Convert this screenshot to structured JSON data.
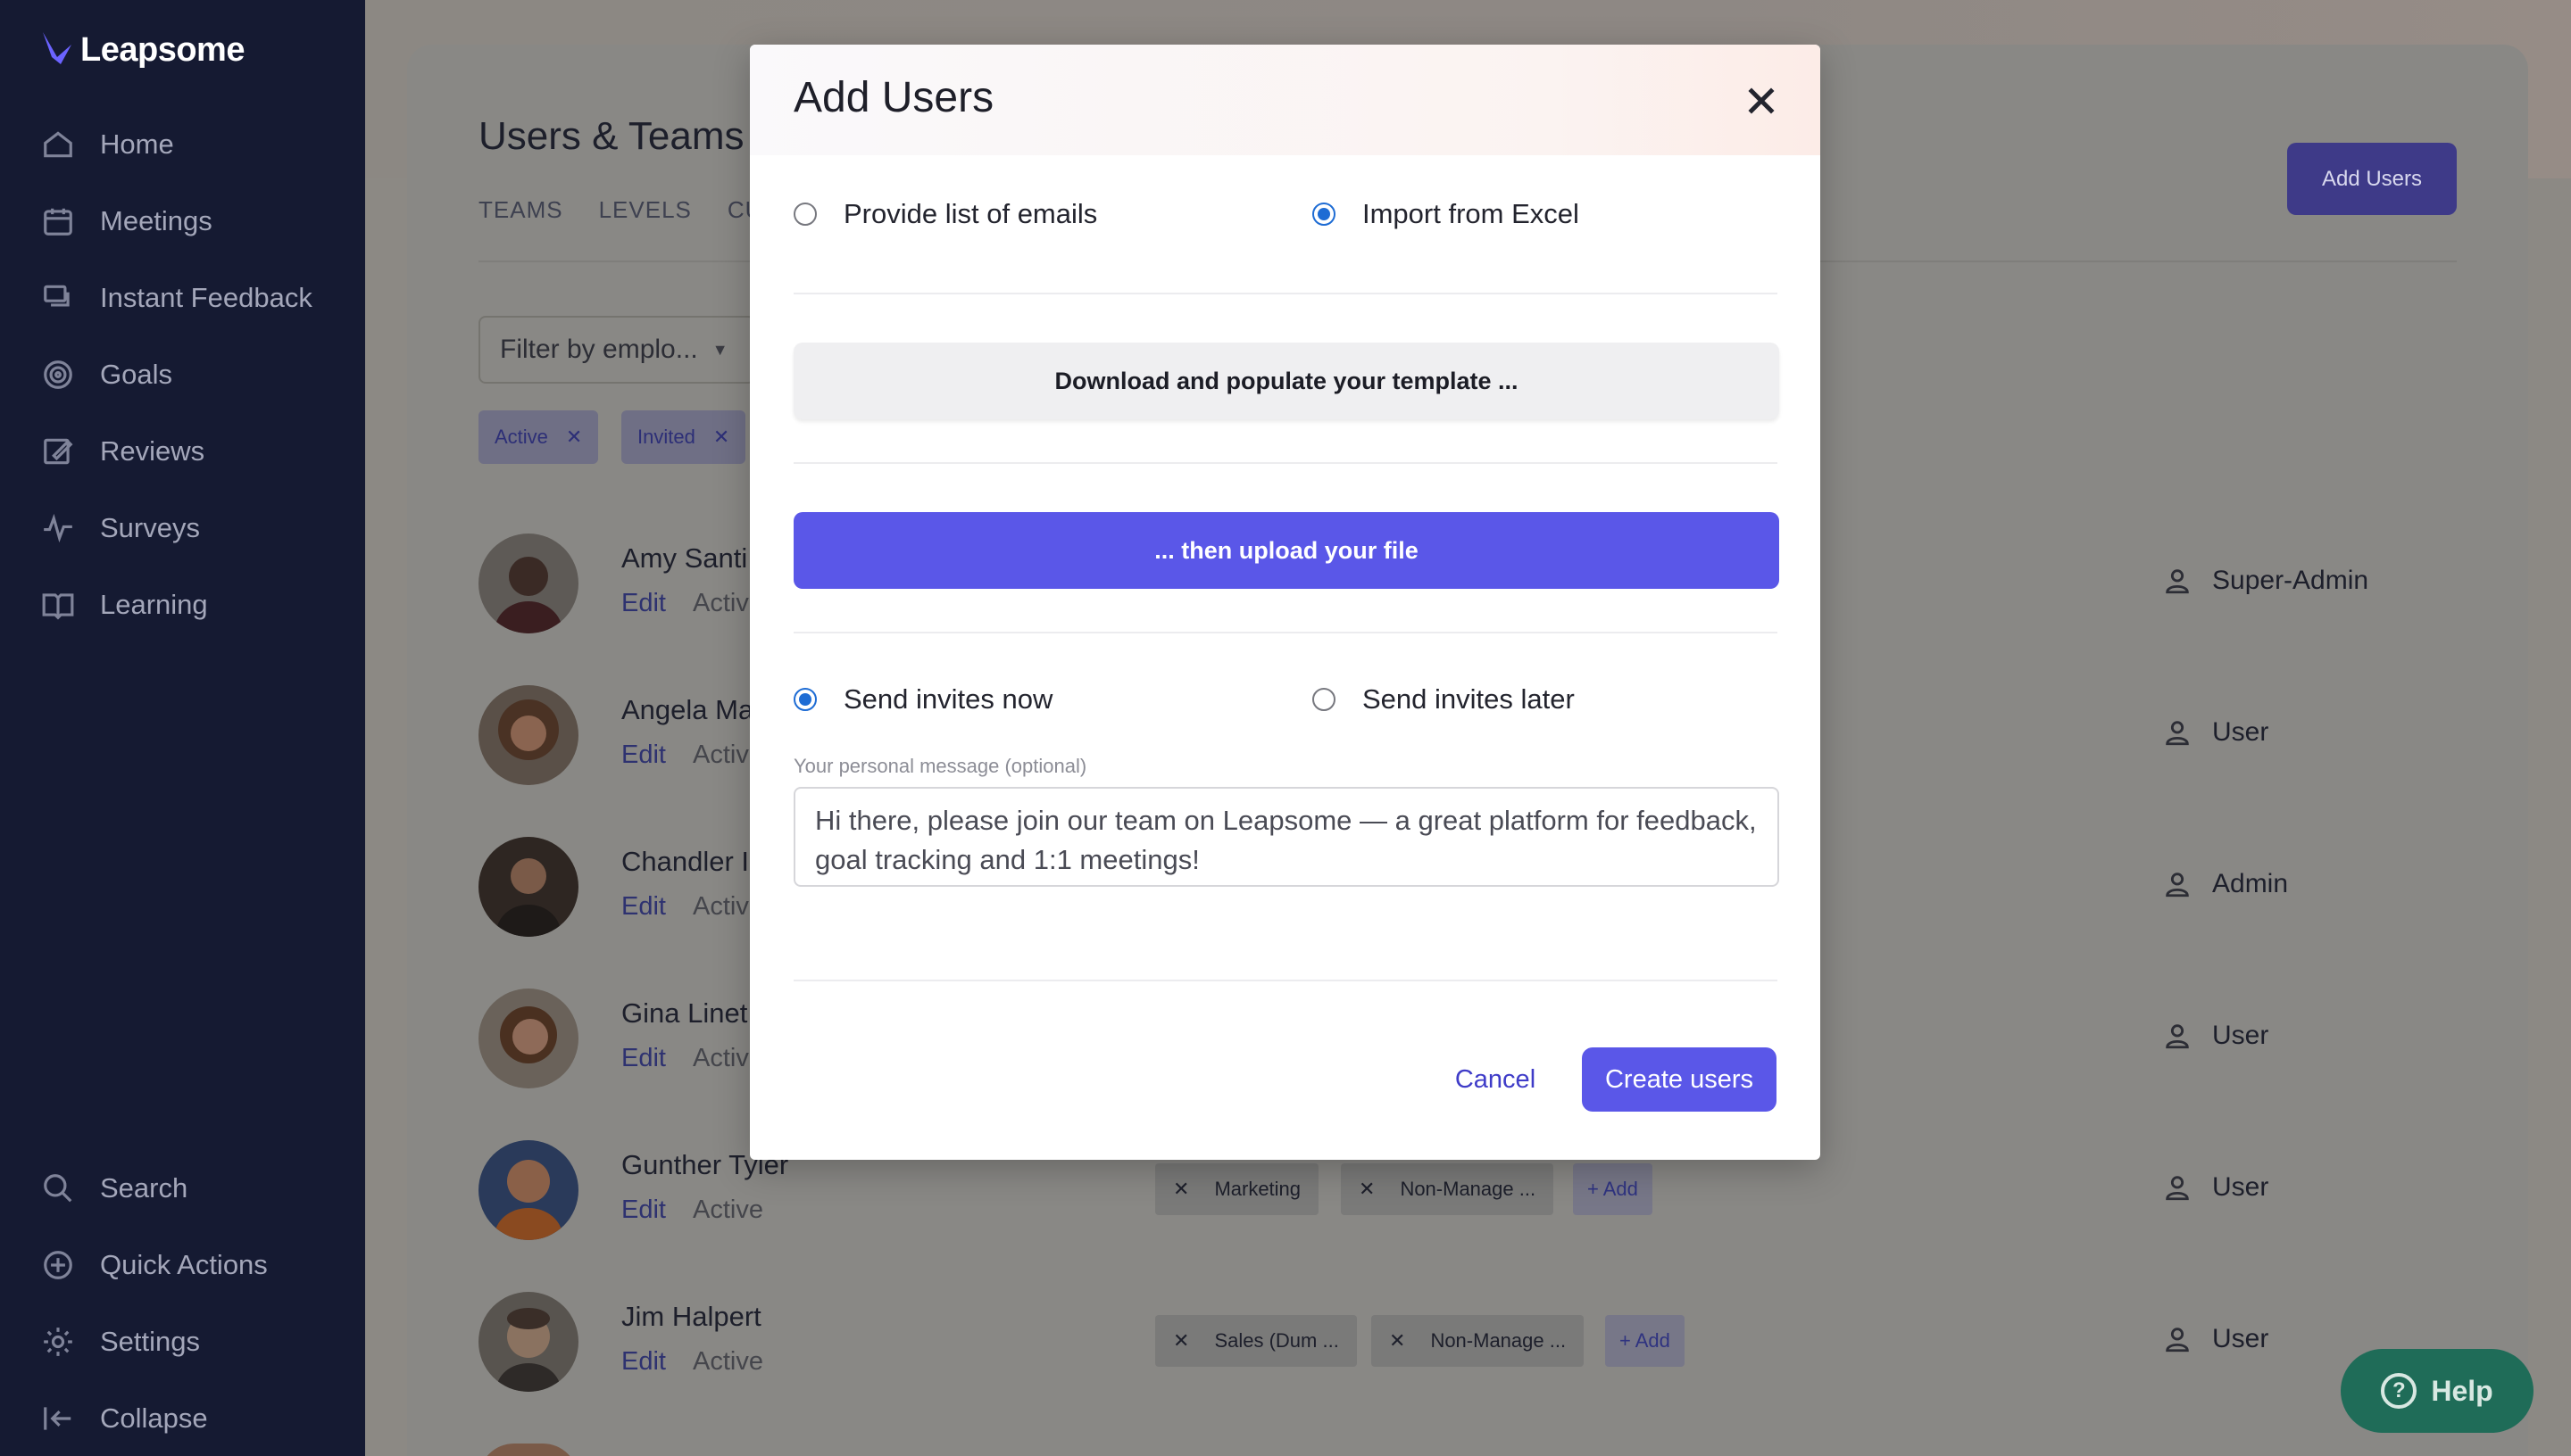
{
  "app": {
    "logo_text": "Leapsome"
  },
  "sidebar": {
    "items": [
      {
        "label": "Home",
        "icon": "home-icon"
      },
      {
        "label": "Meetings",
        "icon": "calendar-icon"
      },
      {
        "label": "Instant Feedback",
        "icon": "chat-icon"
      },
      {
        "label": "Goals",
        "icon": "target-icon"
      },
      {
        "label": "Reviews",
        "icon": "edit-icon"
      },
      {
        "label": "Surveys",
        "icon": "pulse-icon"
      },
      {
        "label": "Learning",
        "icon": "book-icon"
      }
    ],
    "bottom": [
      {
        "label": "Search",
        "icon": "search-icon"
      },
      {
        "label": "Quick Actions",
        "icon": "plus-circle-icon"
      },
      {
        "label": "Settings",
        "icon": "gear-icon"
      },
      {
        "label": "Collapse",
        "icon": "collapse-icon"
      }
    ]
  },
  "page": {
    "title": "Users & Teams",
    "tabs": [
      "TEAMS",
      "LEVELS",
      "CUS"
    ],
    "add_users_label": "Add Users",
    "filter_placeholder": "Filter by emplo...",
    "chips": [
      "Active",
      "Invited"
    ]
  },
  "users": [
    {
      "name": "Amy Santi",
      "edit": "Edit",
      "status": "Activ",
      "role": "Super-Admin",
      "avatar_color": "#4a3530"
    },
    {
      "name": "Angela Ma",
      "edit": "Edit",
      "status": "Activ",
      "role": "User",
      "avatar_color": "#7a5a40"
    },
    {
      "name": "Chandler I",
      "edit": "Edit",
      "status": "Activ",
      "role": "Admin",
      "avatar_color": "#3a2e2a"
    },
    {
      "name": "Gina Linet",
      "edit": "Edit",
      "status": "Activ",
      "role": "User",
      "avatar_color": "#6a4a3a"
    },
    {
      "name": "Gunther Tyler",
      "edit": "Edit",
      "status": "Active",
      "role": "User",
      "avatar_color": "#7a5030",
      "tags": [
        "Marketing",
        "Non-Manage ..."
      ],
      "add_label": "+ Add"
    },
    {
      "name": "Jim Halpert",
      "edit": "Edit",
      "status": "Active",
      "role": "User",
      "avatar_color": "#5a5550",
      "tags": [
        "Sales (Dum ...",
        "Non-Manage ..."
      ],
      "add_label": "+ Add"
    }
  ],
  "help": {
    "label": "Help"
  },
  "modal": {
    "title": "Add Users",
    "source_options": [
      {
        "label": "Provide list of emails",
        "selected": false
      },
      {
        "label": "Import from Excel",
        "selected": true
      }
    ],
    "download_label": "Download and populate your template ...",
    "upload_label": "... then upload your file",
    "invite_options": [
      {
        "label": "Send invites now",
        "selected": true
      },
      {
        "label": "Send invites later",
        "selected": false
      }
    ],
    "message_label": "Your personal message (optional)",
    "message_value": "Hi there, please join our team on Leapsome — a great platform for feedback, goal tracking and 1:1 meetings!",
    "cancel_label": "Cancel",
    "create_label": "Create users"
  },
  "colors": {
    "accent": "#5a57e8",
    "sidebar_bg": "#151a32",
    "radio_on": "#1e6cd4"
  }
}
